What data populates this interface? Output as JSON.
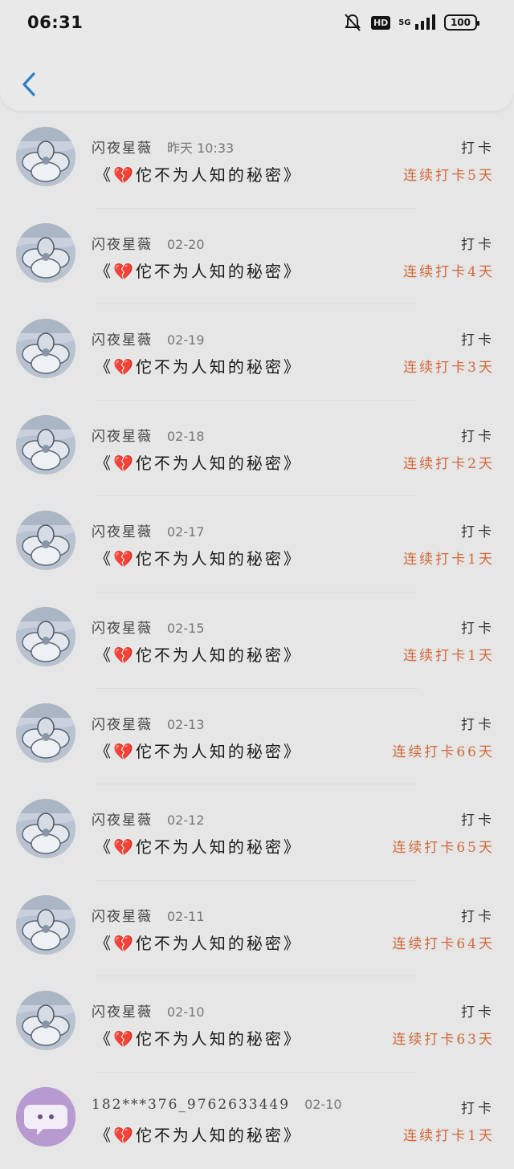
{
  "status_bar": {
    "time": "06:31",
    "network": "5G",
    "hd": "HD",
    "battery": "100"
  },
  "header": {
    "back_icon": "chevron-left-icon"
  },
  "entries": [
    {
      "name": "闪夜星薇",
      "date": "昨天 10:33",
      "message": "《💔佗不为人知的秘密》",
      "tag": "打卡",
      "streak": "连续打卡5天",
      "avatar": "flower"
    },
    {
      "name": "闪夜星薇",
      "date": "02-20",
      "message": "《💔佗不为人知的秘密》",
      "tag": "打卡",
      "streak": "连续打卡4天",
      "avatar": "flower"
    },
    {
      "name": "闪夜星薇",
      "date": "02-19",
      "message": "《💔佗不为人知的秘密》",
      "tag": "打卡",
      "streak": "连续打卡3天",
      "avatar": "flower"
    },
    {
      "name": "闪夜星薇",
      "date": "02-18",
      "message": "《💔佗不为人知的秘密》",
      "tag": "打卡",
      "streak": "连续打卡2天",
      "avatar": "flower"
    },
    {
      "name": "闪夜星薇",
      "date": "02-17",
      "message": "《💔佗不为人知的秘密》",
      "tag": "打卡",
      "streak": "连续打卡1天",
      "avatar": "flower"
    },
    {
      "name": "闪夜星薇",
      "date": "02-15",
      "message": "《💔佗不为人知的秘密》",
      "tag": "打卡",
      "streak": "连续打卡1天",
      "avatar": "flower"
    },
    {
      "name": "闪夜星薇",
      "date": "02-13",
      "message": "《💔佗不为人知的秘密》",
      "tag": "打卡",
      "streak": "连续打卡66天",
      "avatar": "flower"
    },
    {
      "name": "闪夜星薇",
      "date": "02-12",
      "message": "《💔佗不为人知的秘密》",
      "tag": "打卡",
      "streak": "连续打卡65天",
      "avatar": "flower"
    },
    {
      "name": "闪夜星薇",
      "date": "02-11",
      "message": "《💔佗不为人知的秘密》",
      "tag": "打卡",
      "streak": "连续打卡64天",
      "avatar": "flower"
    },
    {
      "name": "闪夜星薇",
      "date": "02-10",
      "message": "《💔佗不为人知的秘密》",
      "tag": "打卡",
      "streak": "连续打卡63天",
      "avatar": "flower"
    },
    {
      "name": "182***376_9762633449",
      "date": "02-10",
      "message": "《💔佗不为人知的秘密》",
      "tag": "打卡",
      "streak": "连续打卡1天",
      "avatar": "default"
    }
  ],
  "colors": {
    "accent": "#d0683a",
    "back": "#2f7fc8"
  }
}
